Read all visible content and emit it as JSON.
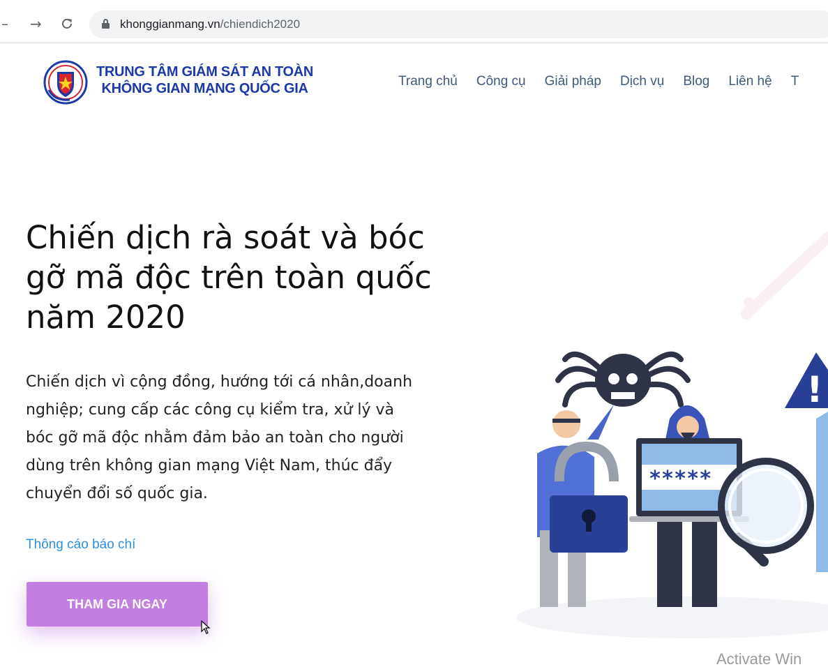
{
  "browser": {
    "url_domain": "khonggianmang.vn",
    "url_path": "/chiendich2020",
    "back_icon": "arrow-left-icon",
    "forward_icon": "arrow-right-icon",
    "reload_icon": "reload-icon",
    "lock_icon": "lock-icon"
  },
  "header": {
    "brand_line1": "TRUNG TÂM GIÁM SÁT AN TOÀN",
    "brand_line2": "KHÔNG GIAN MẠNG QUỐC GIA",
    "nav": [
      "Trang chủ",
      "Công cụ",
      "Giải pháp",
      "Dịch vụ",
      "Blog",
      "Liên hệ",
      "T"
    ]
  },
  "hero": {
    "title_line1": "Chiến dịch rà soát và bóc",
    "title_line2": "gỡ mã độc trên toàn quốc",
    "title_line3": "năm 2020",
    "desc_lines": [
      "Chiến dịch vì cộng đồng, hướng tới cá nhân,doanh",
      "nghiệp; cung cấp các công cụ kiểm tra, xử lý và",
      "bóc gỡ mã độc nhằm đảm bảo an toàn cho người",
      "dùng trên không gian mạng Việt Nam, thúc đẩy",
      "chuyển đổi số quốc gia."
    ],
    "press_link": "Thông cáo báo chí",
    "cta_label": "THAM GIA NGAY"
  },
  "illustration": {
    "password_mask": "*****",
    "warning_mark": "!"
  },
  "os_watermark": "Activate Win",
  "colors": {
    "brand": "#1b3aa8",
    "nav": "#3f5a7a",
    "link": "#2d8fe0",
    "cta": "#c47de0"
  }
}
